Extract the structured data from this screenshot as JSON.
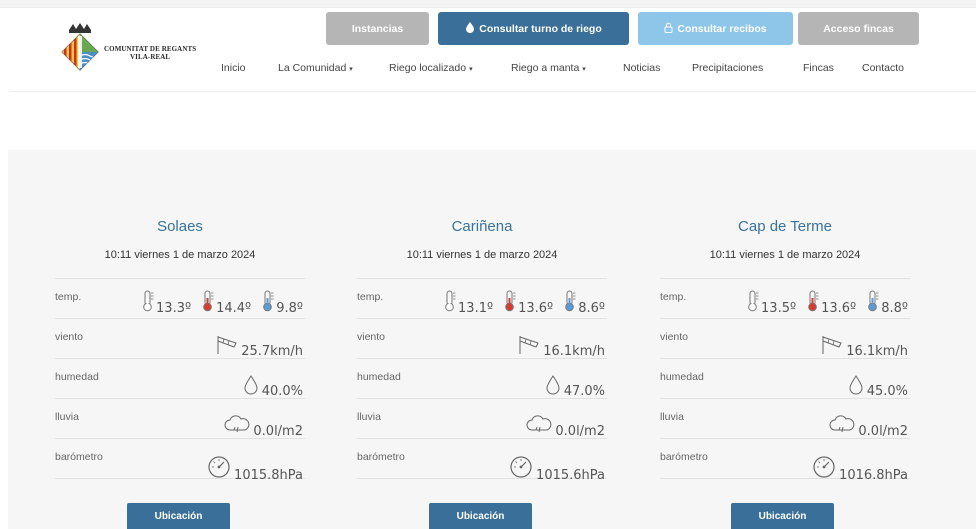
{
  "header": {
    "logo_text_line1": "COMUNITAT DE REGANTS",
    "logo_text_line2": "VILA-REAL",
    "buttons": {
      "instancias": "Instancias",
      "turno": "Consultar turno de riego",
      "recibos": "Consultar recibos",
      "fincas": "Acceso fincas"
    },
    "nav": [
      {
        "label": "Inicio"
      },
      {
        "label": "La Comunidad"
      },
      {
        "label": "Riego localizado"
      },
      {
        "label": "Riego a manta"
      },
      {
        "label": "Noticias"
      },
      {
        "label": "Precipitaciones"
      },
      {
        "label": "Fincas"
      },
      {
        "label": "Contacto"
      }
    ],
    "colors": {
      "primary": "#396f98",
      "light": "#8ec6ea",
      "grey": "#b5b5b5"
    }
  },
  "labels": {
    "temp": "temp.",
    "viento": "viento",
    "humedad": "humedad",
    "lluvia": "lluvia",
    "barometro": "barómetro",
    "ubicacion": "Ubicación"
  },
  "stations": [
    {
      "name": "Solaes",
      "date": "10:11 viernes 1 de marzo 2024",
      "temp_current": "13.3º",
      "temp_max": "14.4º",
      "temp_min": "9.8º",
      "wind": "25.7km/h",
      "humidity": "40.0%",
      "rain": "0.0l/m2",
      "pressure": "1015.8hPa"
    },
    {
      "name": "Cariñena",
      "date": "10:11 viernes 1 de marzo 2024",
      "temp_current": "13.1º",
      "temp_max": "13.6º",
      "temp_min": "8.6º",
      "wind": "16.1km/h",
      "humidity": "47.0%",
      "rain": "0.0l/m2",
      "pressure": "1015.6hPa"
    },
    {
      "name": "Cap de Terme",
      "date": "10:11 viernes 1 de marzo 2024",
      "temp_current": "13.5º",
      "temp_max": "13.6º",
      "temp_min": "8.8º",
      "wind": "16.1km/h",
      "humidity": "45.0%",
      "rain": "0.0l/m2",
      "pressure": "1016.8hPa"
    }
  ]
}
